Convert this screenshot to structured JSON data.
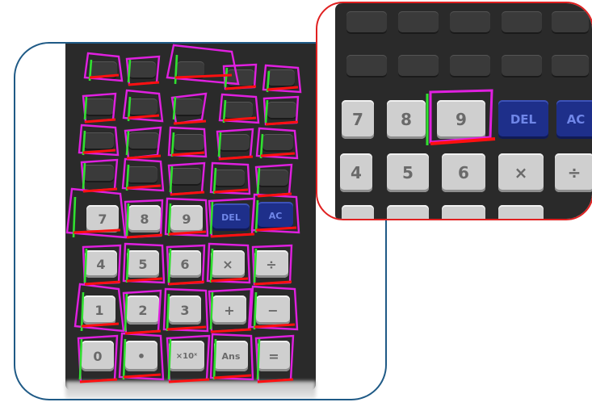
{
  "left_view": {
    "keys_row_digits_1": [
      "7",
      "8",
      "9",
      "DEL",
      "AC"
    ],
    "keys_row_digits_2": [
      "4",
      "5",
      "6",
      "×",
      "÷"
    ],
    "keys_row_digits_3": [
      "1",
      "2",
      "3",
      "+",
      "−"
    ],
    "keys_row_digits_4": [
      "0",
      "•",
      "×10ˣ",
      "Ans",
      "="
    ]
  },
  "zoom_view": {
    "keys_row_1": [
      "7",
      "8",
      "9",
      "DEL",
      "AC"
    ],
    "keys_row_2": [
      "4",
      "5",
      "6",
      "×",
      "÷"
    ]
  },
  "colors": {
    "left_frame": "#1f5a86",
    "zoom_frame": "#e02020",
    "annotation_magenta": "#e020e0",
    "annotation_green": "#30e030",
    "annotation_red": "#ff1010"
  }
}
